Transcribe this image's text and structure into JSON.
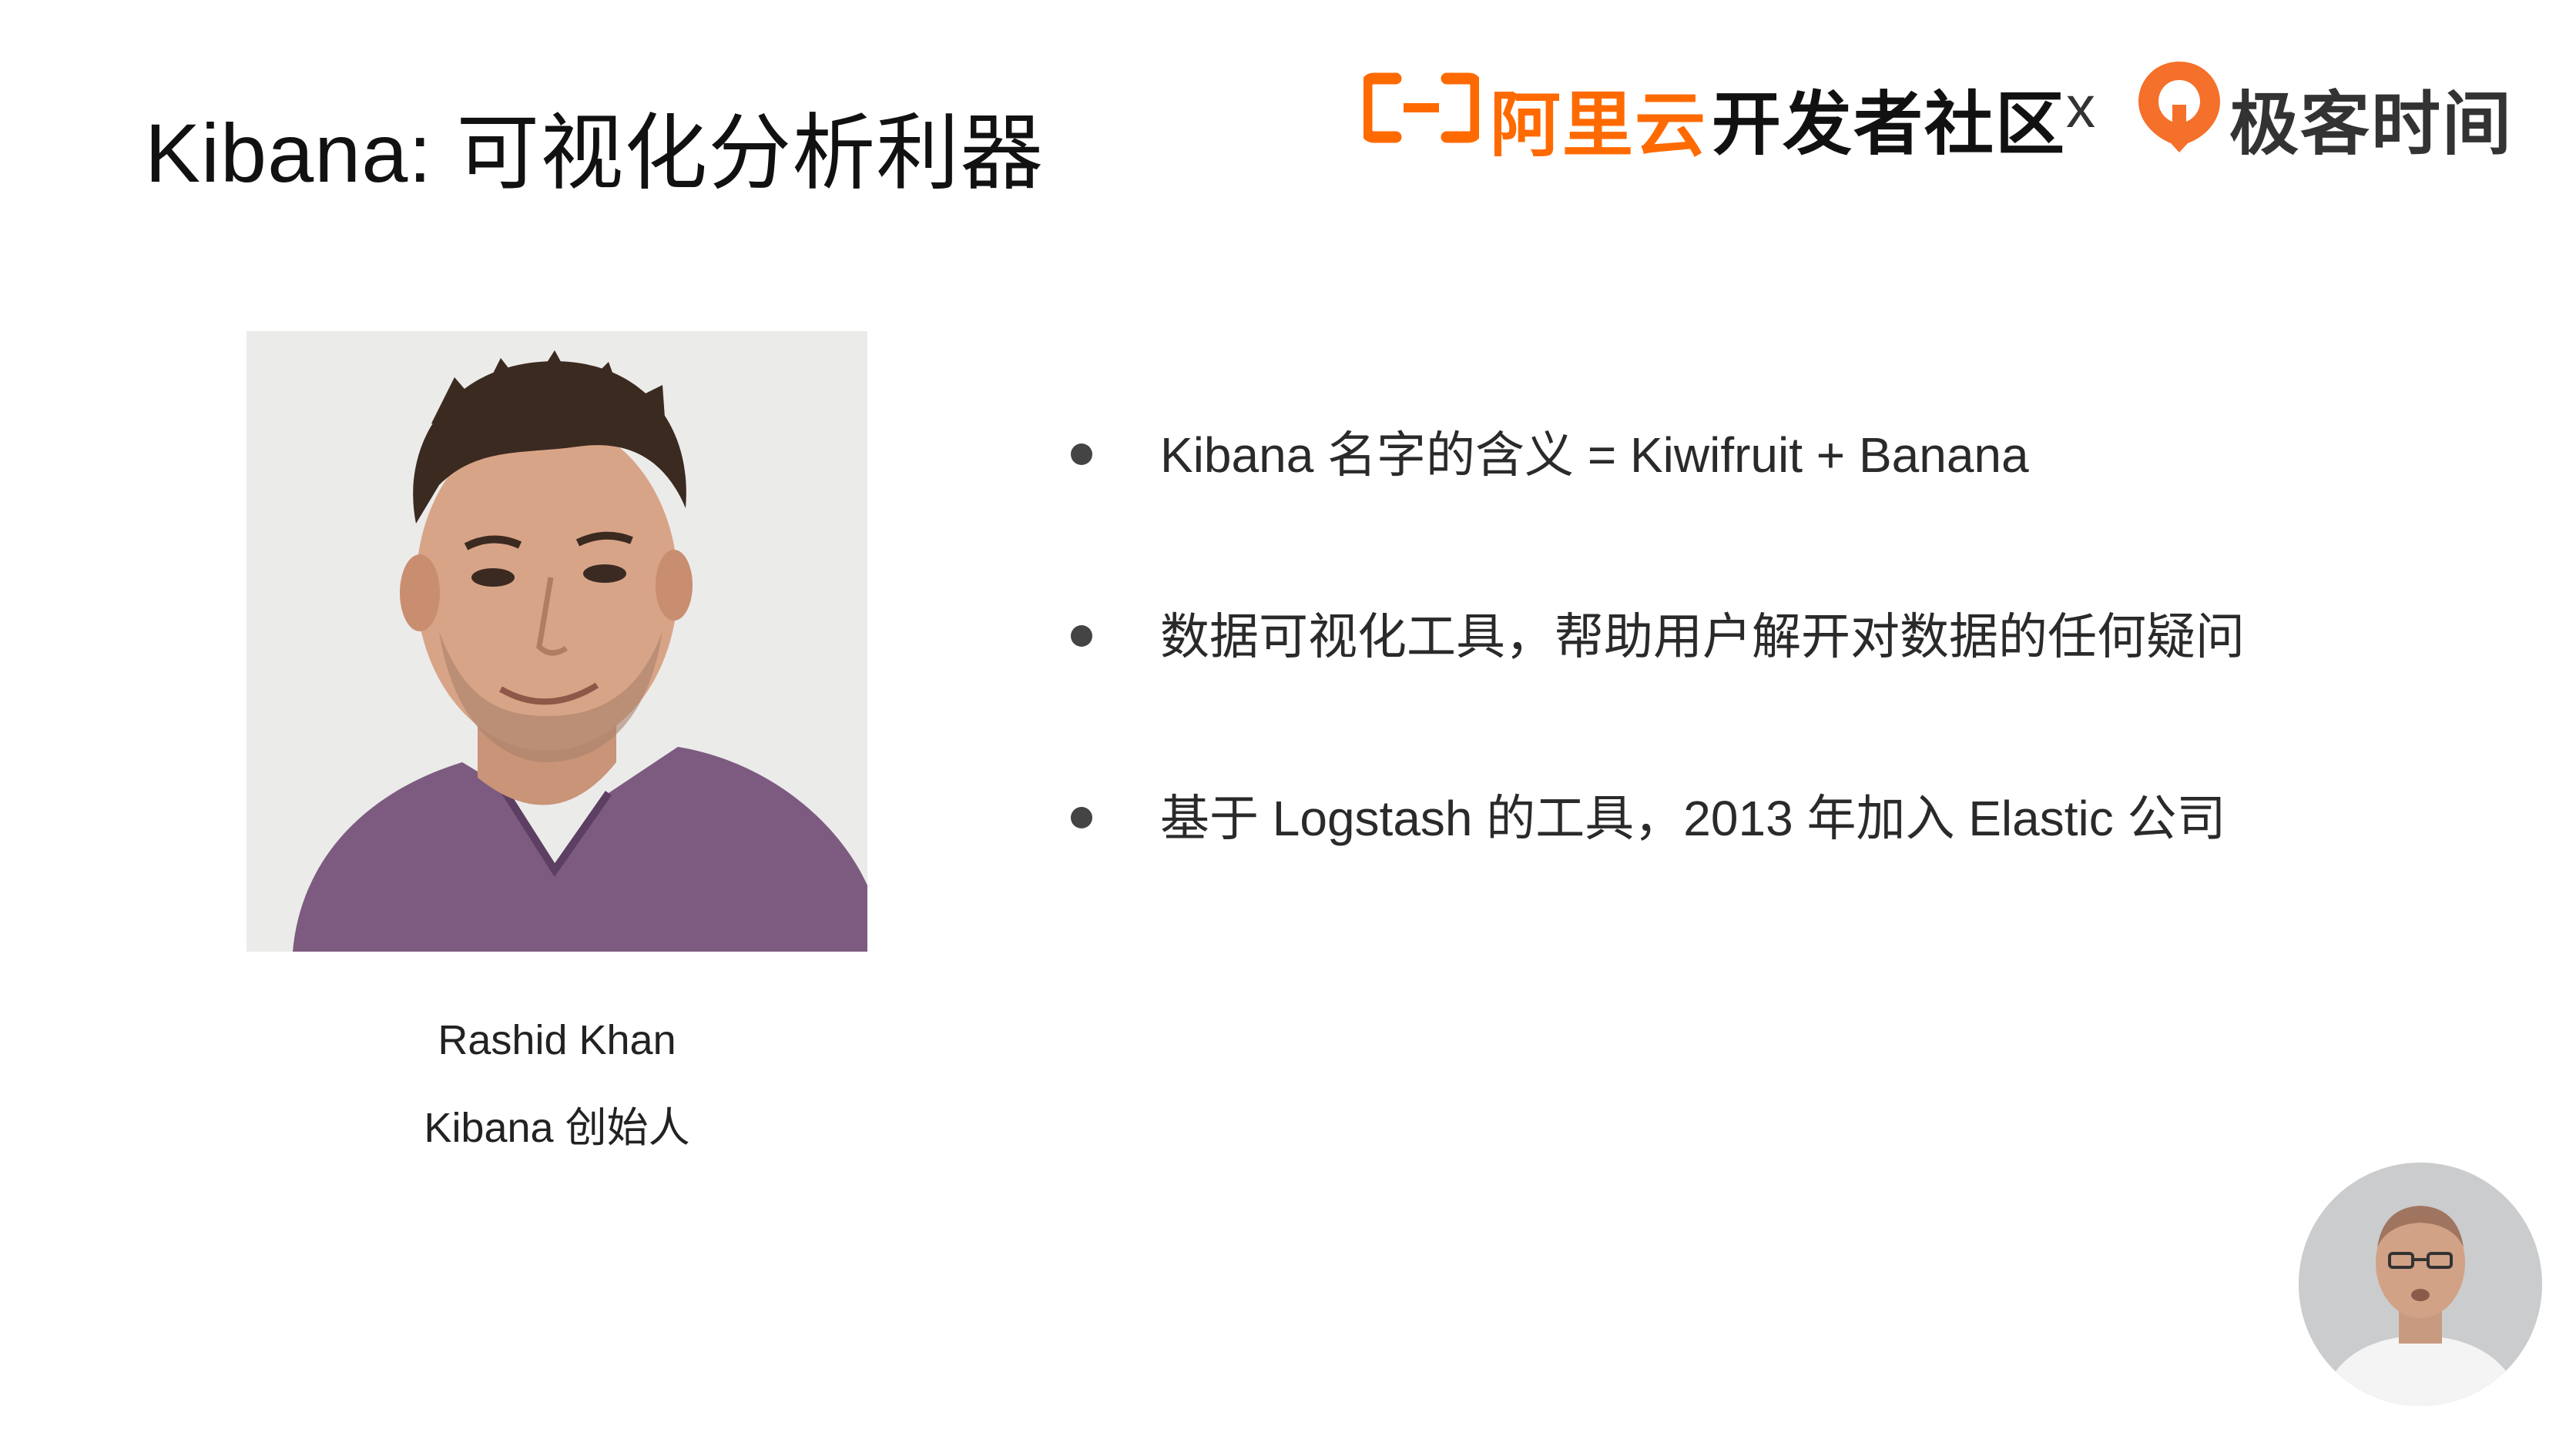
{
  "slide": {
    "title": "Kibana: 可视化分析利器"
  },
  "header": {
    "aliyun_logo_text": "阿里云",
    "dev_community_text": "开发者社区",
    "separator": "x",
    "geektime_logo_text": "极客时间",
    "brand_colors": {
      "aliyun": "#ff6a00",
      "geektime": "#f5702a"
    }
  },
  "profile": {
    "name": "Rashid Khan",
    "role": "Kibana 创始人"
  },
  "bullets": [
    {
      "text": "Kibana 名字的含义 = Kiwifruit + Banana"
    },
    {
      "text": "数据可视化工具，帮助用户解开对数据的任何疑问"
    },
    {
      "text": "基于 Logstash 的工具，2013 年加入 Elastic 公司"
    }
  ]
}
